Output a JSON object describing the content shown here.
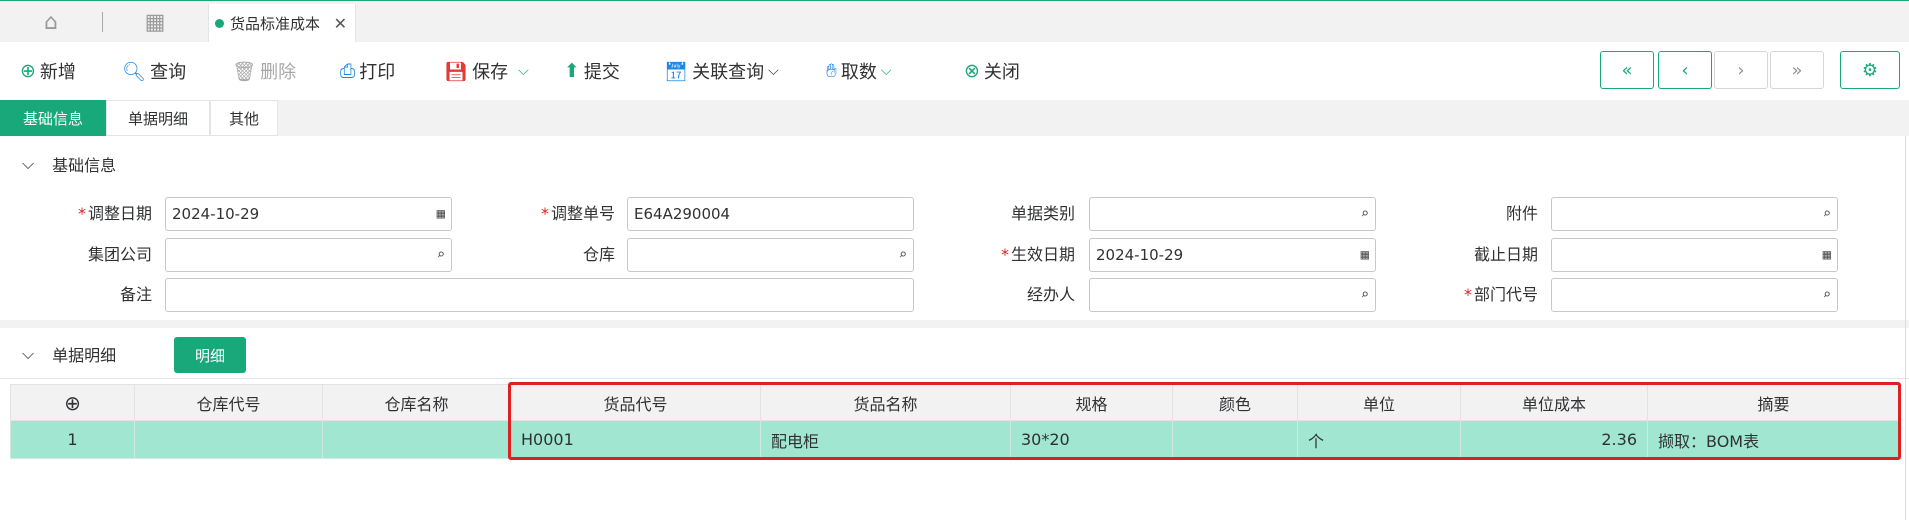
{
  "tabs": {
    "home_icon": "home-icon",
    "apps_icon": "grid-icon",
    "active_tab": "货品标准成本",
    "close": "✕"
  },
  "toolbar": {
    "add": "新增",
    "query": "查询",
    "delete": "删除",
    "print": "打印",
    "save": "保存",
    "submit": "提交",
    "related_query": "关联查询",
    "fetch": "取数",
    "close": "关闭"
  },
  "subtabs": [
    "基础信息",
    "单据明细",
    "其他"
  ],
  "basic_section": {
    "title": "基础信息"
  },
  "form": {
    "adjust_date": {
      "label": "调整日期",
      "value": "2024-10-29"
    },
    "adjust_no": {
      "label": "调整单号",
      "value": "E64A290004"
    },
    "doc_type": {
      "label": "单据类别",
      "value": ""
    },
    "attachment": {
      "label": "附件",
      "value": ""
    },
    "group_company": {
      "label": "集团公司",
      "value": ""
    },
    "warehouse": {
      "label": "仓库",
      "value": ""
    },
    "effective_date": {
      "label": "生效日期",
      "value": "2024-10-29"
    },
    "end_date": {
      "label": "截止日期",
      "value": ""
    },
    "remark": {
      "label": "备注",
      "value": ""
    },
    "handler": {
      "label": "经办人",
      "value": ""
    },
    "dept_code": {
      "label": "部门代号",
      "value": ""
    }
  },
  "detail_section": {
    "title": "单据明细",
    "detail_button": "明细"
  },
  "grid": {
    "add_icon": "⊕",
    "columns": [
      "仓库代号",
      "仓库名称",
      "货品代号",
      "货品名称",
      "规格",
      "颜色",
      "单位",
      "单位成本",
      "摘要"
    ],
    "rows": [
      {
        "index": "1",
        "wh_code": "",
        "wh_name": "",
        "item_code": "H0001",
        "item_name": "配电柜",
        "spec": "30*20",
        "color": "",
        "unit": "个",
        "unit_cost": "2.36",
        "summary": "撷取：BOM表"
      }
    ]
  },
  "colors": {
    "accent": "#19a879",
    "row_selected": "#a0e6d0",
    "highlight": "#e02020"
  }
}
